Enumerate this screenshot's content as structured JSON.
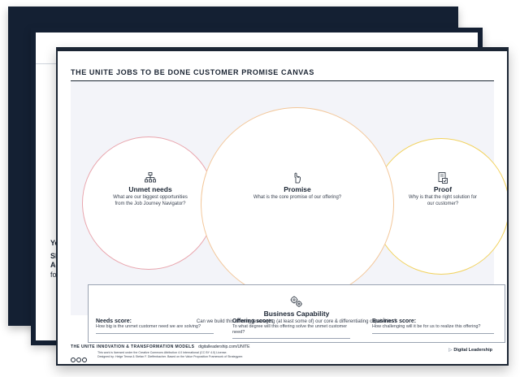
{
  "background_sheet": {
    "texts": [
      "Yo",
      "Sh",
      "Ac",
      "fo"
    ]
  },
  "canvas": {
    "title": "THE UNITE JOBS TO BE DONE CUSTOMER PROMISE CANVAS",
    "needs": {
      "icon": "hierarchy-icon",
      "heading": "Unmet needs",
      "prompt": "What are our biggest opportunities from the Job Journey Navigator?"
    },
    "promise": {
      "icon": "hand-pointer-icon",
      "heading": "Promise",
      "prompt": "What is the core promise of our offering?"
    },
    "proof": {
      "icon": "document-check-icon",
      "heading": "Proof",
      "prompt": "Why is that the right solution for our customer?"
    },
    "capability": {
      "icon": "gears-icon",
      "heading": "Business Capability",
      "prompt": "Can we build this offering leveraging (at least some of) our core & differentiating capabilities?"
    },
    "scores": [
      {
        "label": "Needs score:",
        "question": "How big is the unmet customer need we are solving?"
      },
      {
        "label": "Offering score:",
        "question": "To what degree will this offering solve the unmet customer need?"
      },
      {
        "label": "Business score:",
        "question": "How challenging will it be for us to realize this offering?"
      }
    ],
    "footer": {
      "brand": "THE UNITE INNOVATION & TRANSFORMATION MODELS",
      "url": "digitalleadership.com/UNITE",
      "license": "This work is licensed under the Creative Commons Attribution 4.0 International (CC BY 4.0) License.",
      "credits": "Designed by: Helge Tennø & Stefan F. Dieffenbacher. Based on the Value Proposition Framework of Strategyzer.",
      "logo": "Digital Leadership"
    }
  },
  "colors": {
    "navy": "#1b2533",
    "needs_border": "#e9a5ad",
    "promise_border": "#f3c79a",
    "proof_border": "#f2d25e"
  }
}
